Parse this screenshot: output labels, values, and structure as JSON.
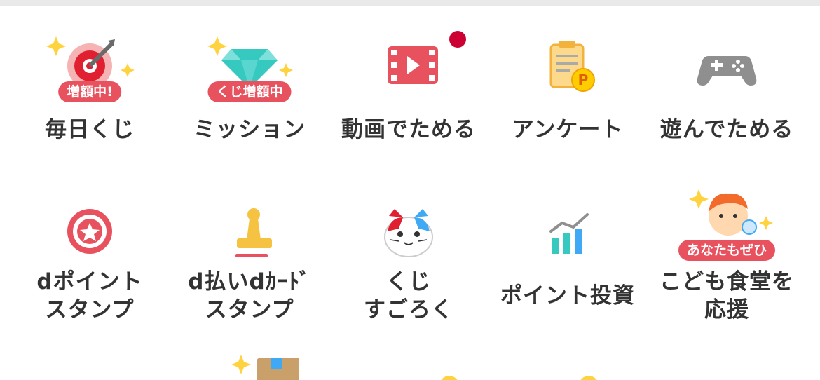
{
  "colors": {
    "accent": "#e8525f",
    "notification_dot": "#cc0033",
    "sparkle": "#ffd23f",
    "text": "#333333"
  },
  "tiles": [
    {
      "label": "毎日くじ",
      "icon": "daily-lottery-target-icon",
      "badge": "増額中!"
    },
    {
      "label": "ミッション",
      "icon": "mission-diamond-icon",
      "badge": "くじ増額中"
    },
    {
      "label": "動画でためる",
      "icon": "video-film-icon",
      "badge": ""
    },
    {
      "label": "アンケート",
      "icon": "survey-clipboard-icon",
      "badge": ""
    },
    {
      "label": "遊んでためる",
      "icon": "game-controller-icon",
      "badge": ""
    },
    {
      "label": "dポイント\nスタンプ",
      "icon": "stamp-badge-icon",
      "badge": ""
    },
    {
      "label": "d払いdｶｰﾄﾞ\nスタンプ",
      "icon": "stamper-icon",
      "badge": ""
    },
    {
      "label": "くじ\nすごろく",
      "icon": "cat-face-icon",
      "badge": ""
    },
    {
      "label": "ポイント投資",
      "icon": "investment-chart-icon",
      "badge": ""
    },
    {
      "label": "こども食堂を\n応援",
      "icon": "child-face-icon",
      "badge": "あなたもぜひ"
    }
  ]
}
